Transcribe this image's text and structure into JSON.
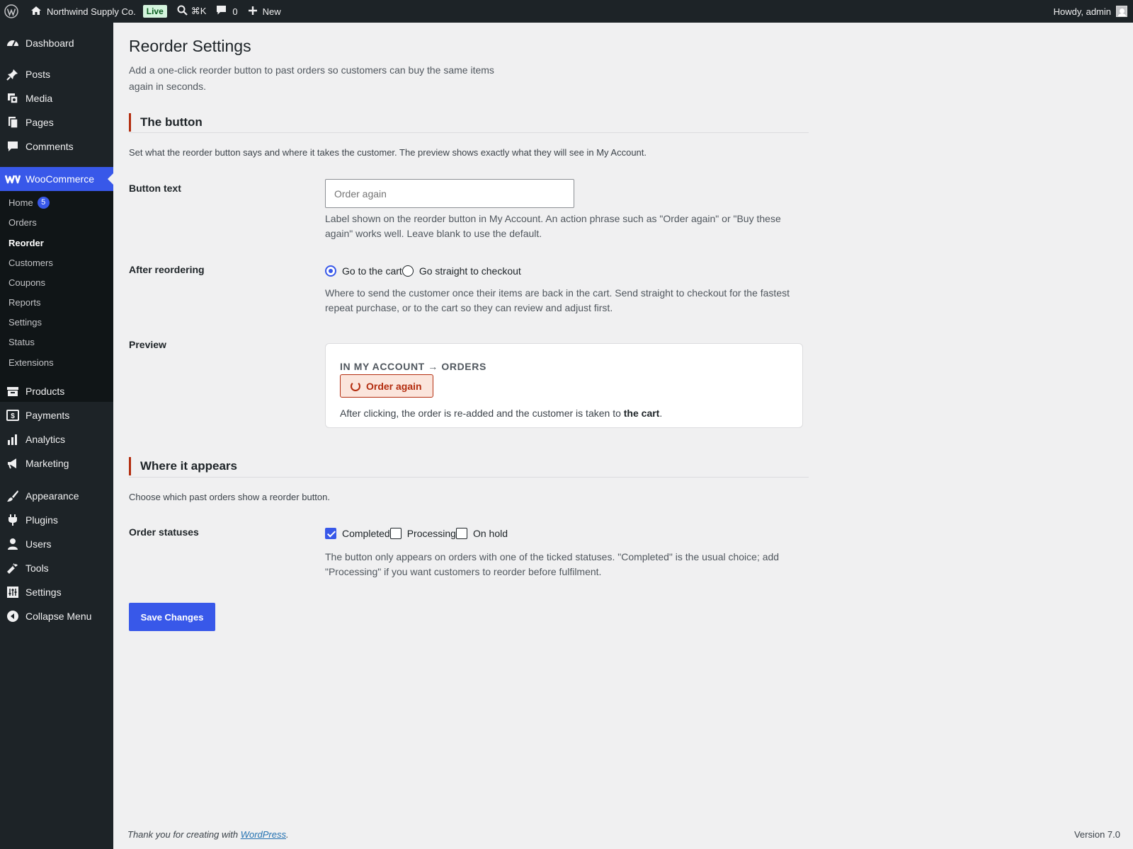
{
  "adminbar": {
    "site_name": "Northwind Supply Co.",
    "live_badge": "Live",
    "search_shortcut": "⌘K",
    "comments_count": "0",
    "new_label": "New",
    "howdy": "Howdy, admin"
  },
  "sidebar": {
    "dashboard": "Dashboard",
    "posts": "Posts",
    "media": "Media",
    "pages": "Pages",
    "comments": "Comments",
    "woocommerce": "WooCommerce",
    "sub": {
      "home": "Home",
      "home_badge": "5",
      "orders": "Orders",
      "reorder": "Reorder",
      "customers": "Customers",
      "coupons": "Coupons",
      "reports": "Reports",
      "settings": "Settings",
      "status": "Status",
      "extensions": "Extensions"
    },
    "products": "Products",
    "payments": "Payments",
    "analytics": "Analytics",
    "marketing": "Marketing",
    "appearance": "Appearance",
    "plugins": "Plugins",
    "users": "Users",
    "tools": "Tools",
    "settings": "Settings",
    "collapse": "Collapse Menu"
  },
  "page": {
    "title": "Reorder Settings",
    "description": "Add a one-click reorder button to past orders so customers can buy the same items again in seconds."
  },
  "section_button": {
    "heading": "The button",
    "description": "Set what the reorder button says and where it takes the customer. The preview shows exactly what they will see in My Account.",
    "button_text_label": "Button text",
    "button_text_value": "",
    "button_text_placeholder": "Order again",
    "button_text_help": "Label shown on the reorder button in My Account. An action phrase such as \"Order again\" or \"Buy these again\" works well. Leave blank to use the default.",
    "after_label": "After reordering",
    "after_options": [
      "Go to the cart",
      "Go straight to checkout"
    ],
    "after_selected": "Go to the cart",
    "after_help": "Where to send the customer once their items are back in the cart. Send straight to checkout for the fastest repeat purchase, or to the cart so they can review and adjust first.",
    "preview_label": "Preview",
    "preview_kicker": "IN MY ACCOUNT → ORDERS",
    "preview_button": "Order again",
    "preview_note_prefix": "After clicking, the order is re-added and the customer is taken to ",
    "preview_note_target": "the cart",
    "preview_note_suffix": "."
  },
  "section_where": {
    "heading": "Where it appears",
    "description": "Choose which past orders show a reorder button.",
    "statuses_label": "Order statuses",
    "statuses": [
      {
        "label": "Completed",
        "checked": true
      },
      {
        "label": "Processing",
        "checked": false
      },
      {
        "label": "On hold",
        "checked": false
      }
    ],
    "statuses_help": "The button only appears on orders with one of the ticked statuses. \"Completed\" is the usual choice; add \"Processing\" if you want customers to reorder before fulfilment."
  },
  "actions": {
    "save": "Save Changes"
  },
  "footer": {
    "thanks_prefix": "Thank you for creating with ",
    "thanks_link": "WordPress",
    "thanks_suffix": ".",
    "version": "Version 7.0"
  },
  "colors": {
    "accent": "#3858e9",
    "section_marker": "#b32d0f",
    "admin_dark": "#1d2327"
  }
}
